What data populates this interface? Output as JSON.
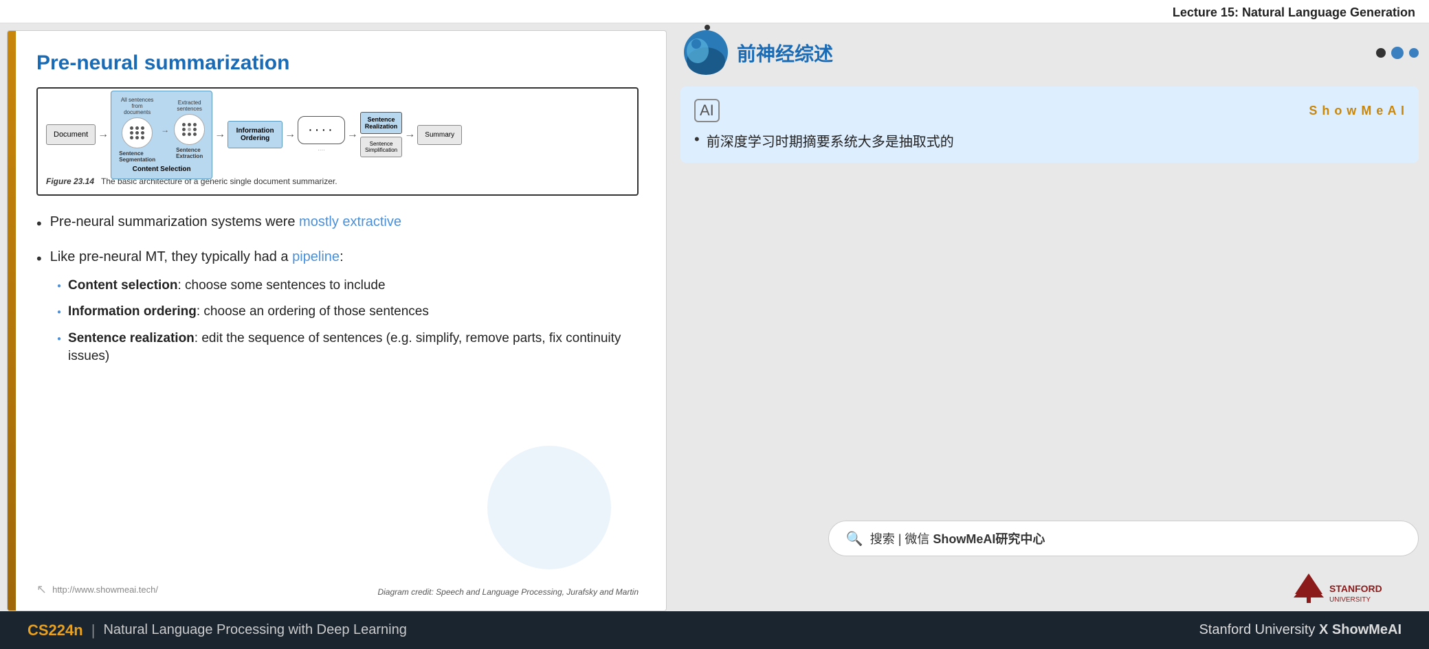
{
  "header": {
    "lecture_title": "Lecture 15: Natural Language Generation"
  },
  "slide": {
    "title": "Pre-neural summarization",
    "diagram": {
      "figure_label": "Figure 23.14",
      "figure_caption": "The basic architecture of a generic single document summarizer.",
      "nodes": [
        {
          "id": "document",
          "label": "Document"
        },
        {
          "id": "sentence_segmentation",
          "label": "Sentence\nSegmentation"
        },
        {
          "id": "all_sentences",
          "label": "All sentences\nfrom documents"
        },
        {
          "id": "sentence_extraction",
          "label": "Sentence\nExtraction"
        },
        {
          "id": "extracted_sentences",
          "label": "Extracted\nsentences"
        },
        {
          "id": "content_selection",
          "label": "Content Selection"
        },
        {
          "id": "information_ordering",
          "label": "Information\nOrdering"
        },
        {
          "id": "sentence_realization",
          "label": "Sentence\nRealization"
        },
        {
          "id": "sentence_simplification",
          "label": "Sentence\nSimplification"
        },
        {
          "id": "summary",
          "label": "Summary"
        }
      ]
    },
    "bullets": [
      {
        "text_plain": "Pre-neural summarization systems were ",
        "text_highlight": "mostly extractive",
        "highlight_color": "#4a90d9"
      },
      {
        "text_plain": "Like pre-neural MT, they typically had a ",
        "text_highlight": "pipeline",
        "highlight_color": "#4a90d9",
        "text_suffix": ":",
        "sub_bullets": [
          {
            "bold": "Content selection",
            "rest": ": choose some sentences to include"
          },
          {
            "bold": "Information ordering",
            "rest": ": choose an ordering of those sentences"
          },
          {
            "bold": "Sentence realization",
            "rest": ": edit the sequence of sentences (e.g. simplify, remove parts, fix continuity issues)"
          }
        ]
      }
    ],
    "footer": {
      "url": "http://www.showmeai.tech/",
      "diagram_credit": "Diagram credit: Speech and Language Processing, Jurafsky and Martin"
    }
  },
  "right_panel": {
    "cn_title": "前神经综述",
    "nav_dots": [
      "inactive",
      "active",
      "inactive"
    ],
    "card": {
      "brand": "S h o w M e A I",
      "bullet": "前深度学习时期摘要系统大多是抽取式的"
    },
    "search": {
      "text_plain": "搜索 | 微信 ",
      "text_bold": "ShowMeAI研究中心"
    }
  },
  "footer": {
    "cs_label": "CS224n",
    "subtitle": "Natural Language Processing with Deep Learning",
    "right_text_plain": "Stanford University ",
    "right_text_bold": "X ShowMeAI"
  }
}
